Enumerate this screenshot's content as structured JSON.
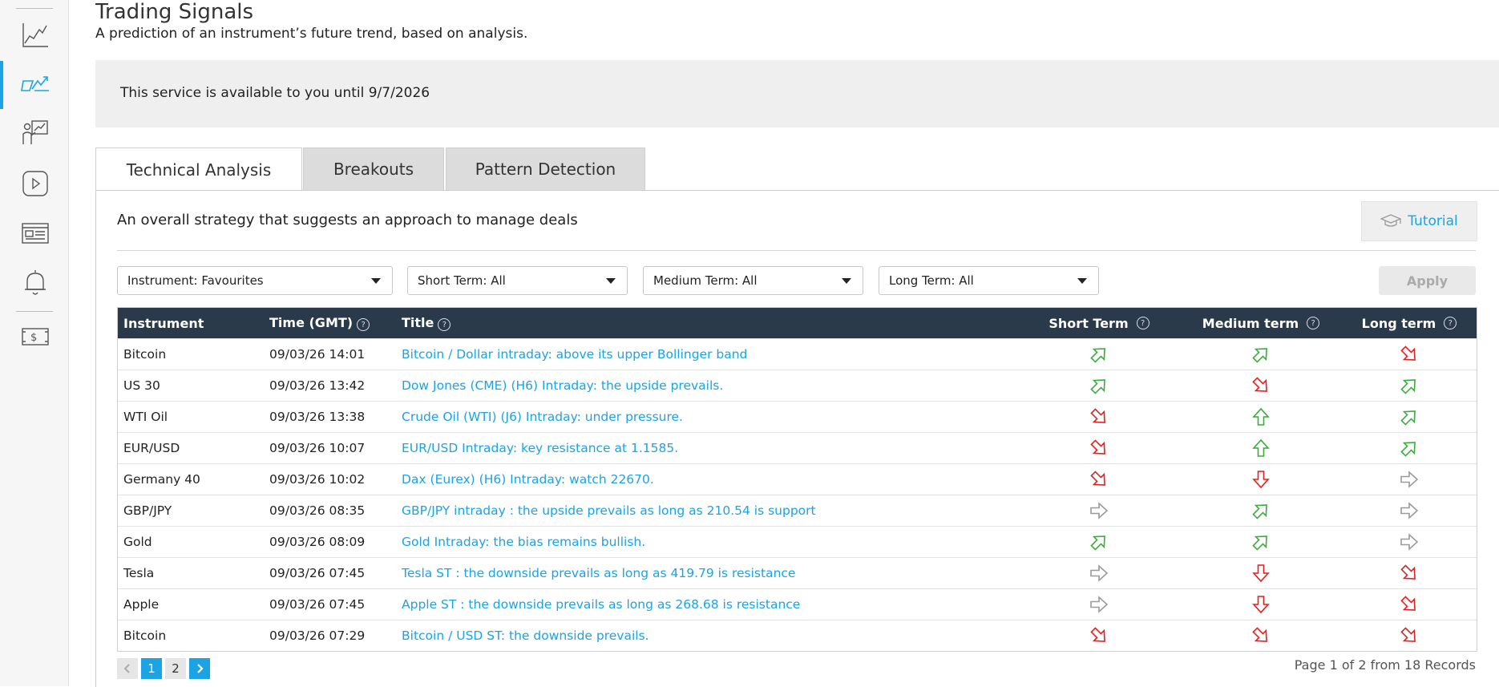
{
  "header": {
    "title": "Trading Signals",
    "subtitle": "A prediction of an instrument’s future trend, based on analysis."
  },
  "notice": "This service is available to you until 9/7/2026",
  "tabs": [
    "Technical Analysis",
    "Breakouts",
    "Pattern Detection"
  ],
  "active_tab": "Technical Analysis",
  "strategy_text": "An overall strategy that suggests an approach to manage deals",
  "tutorial_label": "Tutorial",
  "filters": {
    "instrument": "Instrument: Favourites",
    "short": "Short Term: All",
    "medium": "Medium Term: All",
    "long": "Long Term: All",
    "apply": "Apply"
  },
  "table": {
    "headers": {
      "instrument": "Instrument",
      "time": "Time (GMT)",
      "title": "Title",
      "short": "Short Term",
      "medium": "Medium term",
      "long": "Long term"
    },
    "rows": [
      {
        "instrument": "Bitcoin",
        "time": "09/03/26 14:01",
        "title": "Bitcoin / Dollar intraday: above its upper Bollinger band",
        "short": "up-right",
        "medium": "up-right",
        "long": "down-right"
      },
      {
        "instrument": "US 30",
        "time": "09/03/26 13:42",
        "title": "Dow Jones (CME) (H6) Intraday: the upside prevails.",
        "short": "up-right",
        "medium": "down-right",
        "long": "up-right"
      },
      {
        "instrument": "WTI Oil",
        "time": "09/03/26 13:38",
        "title": "Crude Oil (WTI) (J6) Intraday: under pressure.",
        "short": "down-right",
        "medium": "up",
        "long": "up-right"
      },
      {
        "instrument": "EUR/USD",
        "time": "09/03/26 10:07",
        "title": "EUR/USD Intraday: key resistance at 1.1585.",
        "short": "down-right",
        "medium": "up",
        "long": "up-right"
      },
      {
        "instrument": "Germany 40",
        "time": "09/03/26 10:02",
        "title": "Dax (Eurex) (H6) Intraday: watch 22670.",
        "short": "down-right",
        "medium": "down",
        "long": "right"
      },
      {
        "instrument": "GBP/JPY",
        "time": "09/03/26 08:35",
        "title": "GBP/JPY intraday : the upside prevails as long as 210.54 is support",
        "short": "right",
        "medium": "up-right",
        "long": "right"
      },
      {
        "instrument": "Gold",
        "time": "09/03/26 08:09",
        "title": "Gold Intraday: the bias remains bullish.",
        "short": "up-right",
        "medium": "up-right",
        "long": "right"
      },
      {
        "instrument": "Tesla",
        "time": "09/03/26 07:45",
        "title": "Tesla ST : the downside prevails as long as 419.79 is resistance",
        "short": "right",
        "medium": "down",
        "long": "down-right"
      },
      {
        "instrument": "Apple",
        "time": "09/03/26 07:45",
        "title": "Apple ST : the downside prevails as long as 268.68 is resistance",
        "short": "right",
        "medium": "down",
        "long": "down-right"
      },
      {
        "instrument": "Bitcoin",
        "time": "09/03/26 07:29",
        "title": "Bitcoin / USD ST: the downside prevails.",
        "short": "down-right",
        "medium": "down-right",
        "long": "down-right"
      }
    ]
  },
  "pagination": {
    "pages": [
      "1",
      "2"
    ],
    "current": "1",
    "summary": "Page 1 of 2 from 18 Records"
  },
  "colors": {
    "accent": "#1ba3e4",
    "header_bg": "#2b3a4a",
    "up": "#3bab3b",
    "down": "#e02020",
    "neutral": "#9a9a9a"
  }
}
